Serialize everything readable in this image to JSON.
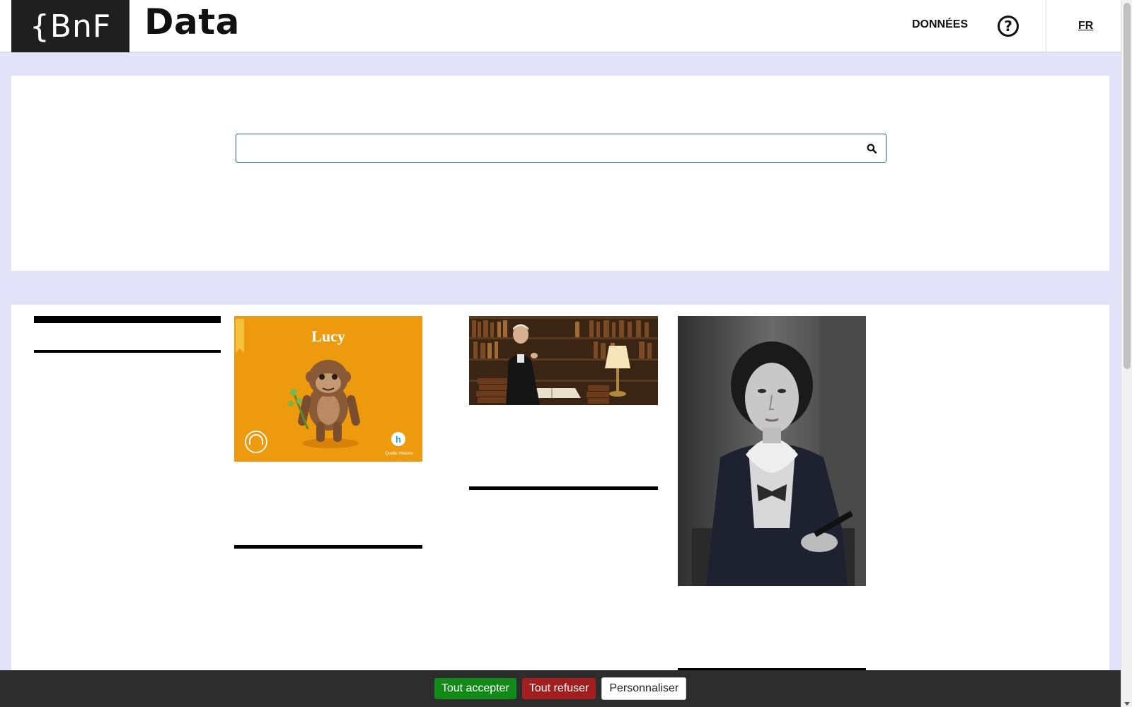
{
  "header": {
    "logo_text": "{BnF",
    "site_title": "Data",
    "nav_donnees": "DONNÉES",
    "help_symbol": "?",
    "lang": "FR"
  },
  "search": {
    "placeholder": "",
    "value": "",
    "button_icon": "search-icon"
  },
  "cards": [
    {
      "image_title": "Lucy",
      "image_publisher": "Quelle Histoire",
      "image_icon": "audio-headphones-icon"
    },
    {
      "image_desc": "man-in-library-photo"
    },
    {
      "image_desc": "woman-portrait-photo"
    }
  ],
  "cookie": {
    "accept_label": "Tout accepter",
    "refuse_label": "Tout refuser",
    "customize_label": "Personnaliser"
  },
  "colors": {
    "page_bg": "#e2e2f8",
    "logo_bg": "#1f1f1f",
    "accept": "#118a18",
    "refuse": "#a31f1f",
    "lucy_bg": "#ee9a0e"
  }
}
